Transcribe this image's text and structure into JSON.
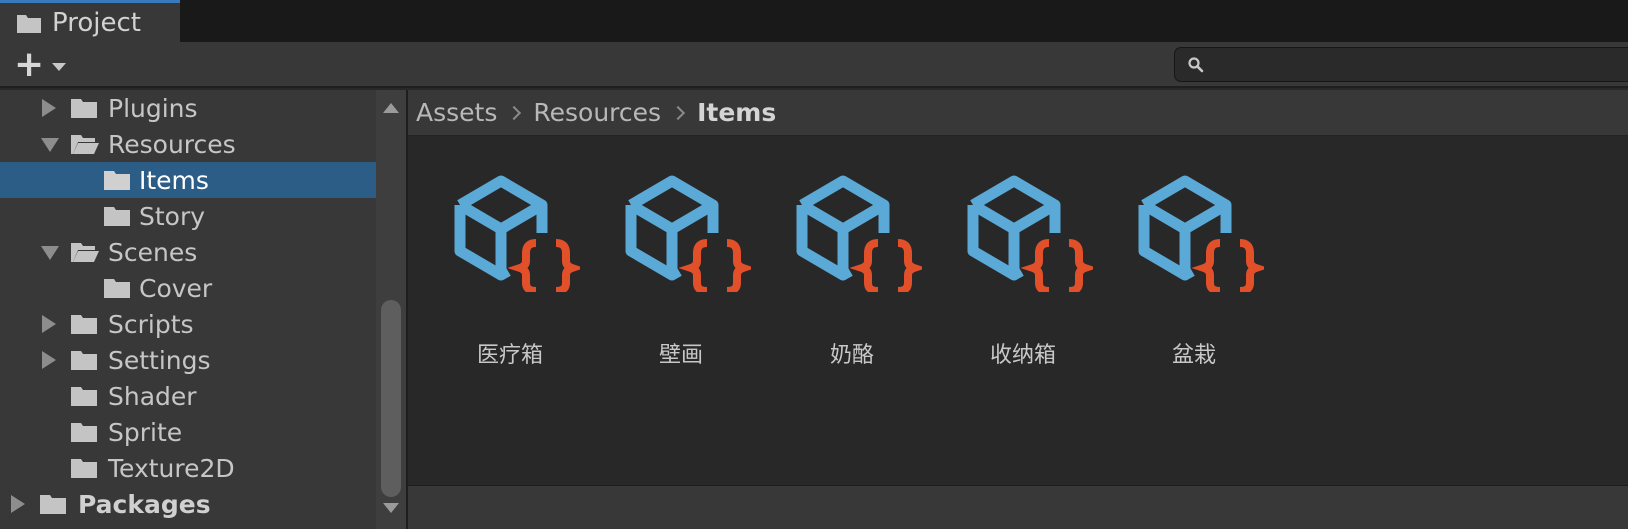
{
  "window": {
    "tab_title": "Project"
  },
  "toolbar": {
    "add_icon": "plus-icon",
    "search_placeholder": ""
  },
  "tree": {
    "items": [
      {
        "label": "Plugins",
        "expanded": false
      },
      {
        "label": "Resources",
        "expanded": true
      },
      {
        "label": "Items",
        "selected": true
      },
      {
        "label": "Story"
      },
      {
        "label": "Scenes",
        "expanded": true
      },
      {
        "label": "Cover"
      },
      {
        "label": "Scripts",
        "expanded": false
      },
      {
        "label": "Settings",
        "expanded": false
      },
      {
        "label": "Shader"
      },
      {
        "label": "Sprite"
      },
      {
        "label": "Texture2D"
      },
      {
        "label": "Packages",
        "expanded": false
      }
    ]
  },
  "breadcrumb": [
    "Assets",
    "Resources",
    "Items"
  ],
  "assets": [
    {
      "name": "医疗箱",
      "icon": "scriptable-object-icon"
    },
    {
      "name": "壁画",
      "icon": "scriptable-object-icon"
    },
    {
      "name": "奶酪",
      "icon": "scriptable-object-icon"
    },
    {
      "name": "收纳箱",
      "icon": "scriptable-object-icon"
    },
    {
      "name": "盆栽",
      "icon": "scriptable-object-icon"
    }
  ],
  "colors": {
    "selection": "#2c5d87",
    "cube_blue": "#5aa9d6",
    "brace_orange": "#e2502a",
    "tab_accent": "#3a79bb"
  }
}
